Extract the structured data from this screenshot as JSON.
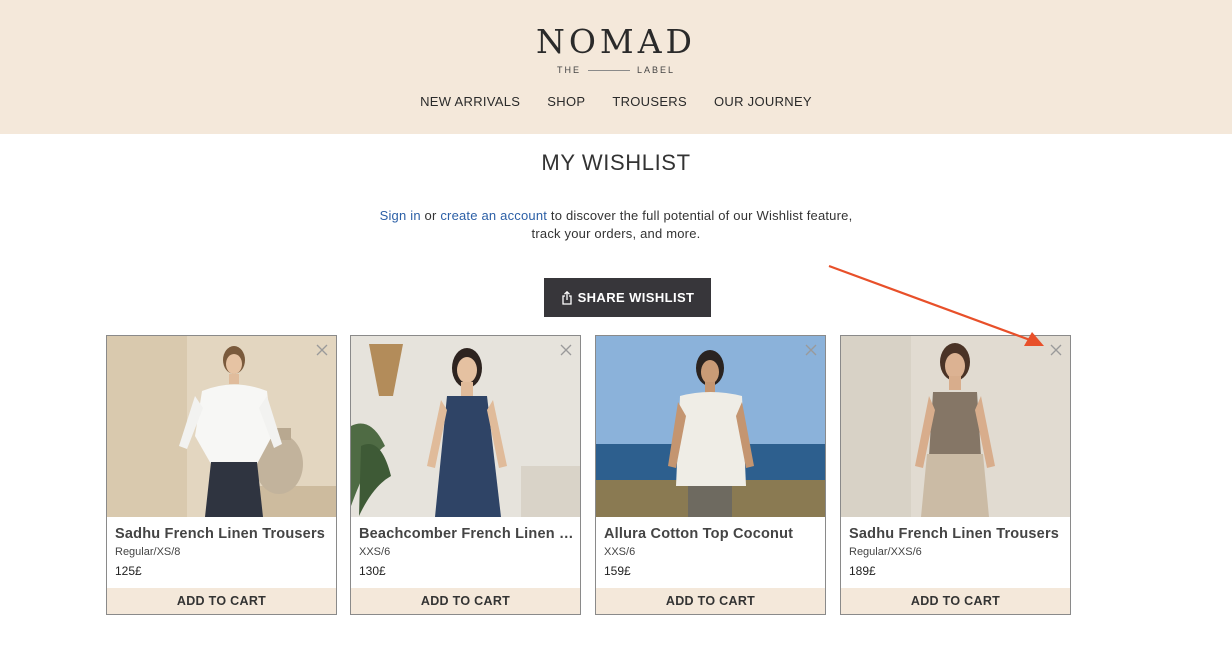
{
  "brand": {
    "name": "NOMAD",
    "sub_left": "THE",
    "sub_right": "LABEL"
  },
  "nav": [
    {
      "label": "NEW ARRIVALS"
    },
    {
      "label": "SHOP"
    },
    {
      "label": "TROUSERS"
    },
    {
      "label": "OUR JOURNEY"
    }
  ],
  "page": {
    "title": "MY WISHLIST",
    "info": {
      "signin": "Sign in",
      "or": " or ",
      "create": "create an account",
      "rest_line1": " to discover the full potential of our Wishlist feature,",
      "rest_line2": "track your orders, and more."
    },
    "share_label": "SHARE WISHLIST"
  },
  "products": [
    {
      "name": "Sadhu French Linen Trousers",
      "variant": "Regular/XS/8",
      "price": "125£",
      "cart_label": "ADD TO CART"
    },
    {
      "name": "Beachcomber French Linen Dress",
      "variant": "XXS/6",
      "price": "130£",
      "cart_label": "ADD TO CART"
    },
    {
      "name": "Allura Cotton Top Coconut",
      "variant": "XXS/6",
      "price": "159£",
      "cart_label": "ADD TO CART"
    },
    {
      "name": "Sadhu French Linen Trousers",
      "variant": "Regular/XXS/6",
      "price": "189£",
      "cart_label": "ADD TO CART"
    }
  ],
  "colors": {
    "header_bg": "#f4e8da",
    "button_dark": "#37363a",
    "link": "#2b5fa6",
    "annotation_arrow": "#e8502a"
  }
}
